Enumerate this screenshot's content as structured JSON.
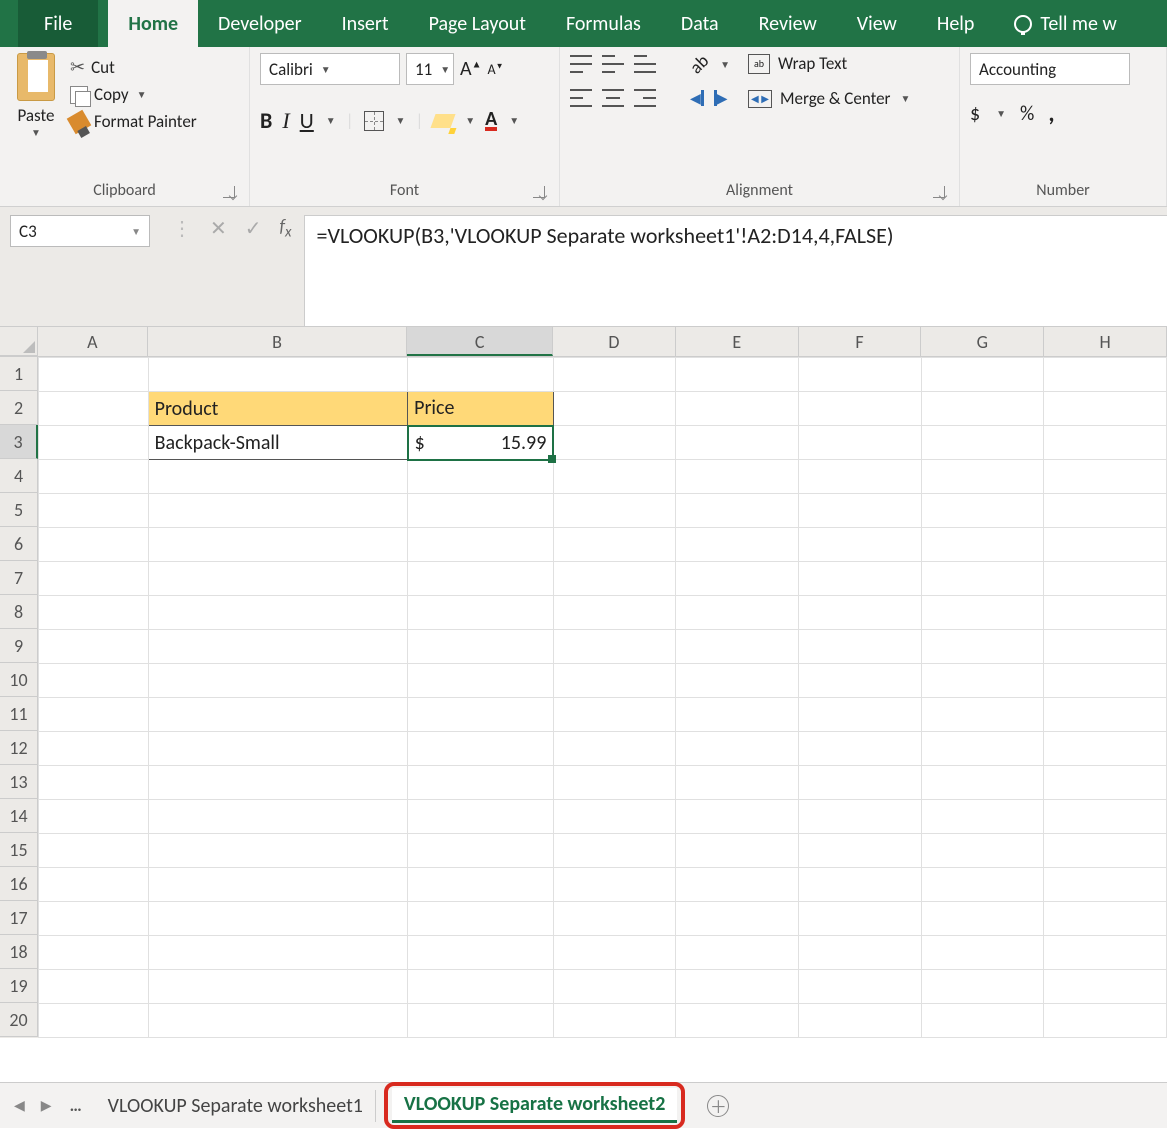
{
  "tabs": {
    "file": "File",
    "home": "Home",
    "developer": "Developer",
    "insert": "Insert",
    "page_layout": "Page Layout",
    "formulas": "Formulas",
    "data": "Data",
    "review": "Review",
    "view": "View",
    "help": "Help",
    "tellme": "Tell me w"
  },
  "ribbon": {
    "clipboard": {
      "paste": "Paste",
      "cut": "Cut",
      "copy": "Copy",
      "format_painter": "Format Painter",
      "group_label": "Clipboard"
    },
    "font": {
      "name": "Calibri",
      "size": "11",
      "group_label": "Font"
    },
    "alignment": {
      "wrap": "Wrap Text",
      "merge": "Merge & Center",
      "group_label": "Alignment"
    },
    "number": {
      "format": "Accounting",
      "dollar": "$",
      "percent": "%",
      "comma": ",",
      "group_label": "Number"
    }
  },
  "formula_bar": {
    "namebox": "C3",
    "formula": "=VLOOKUP(B3,'VLOOKUP Separate worksheet1'!A2:D14,4,FALSE)"
  },
  "columns": [
    "A",
    "B",
    "C",
    "D",
    "E",
    "F",
    "G",
    "H"
  ],
  "rows": [
    "1",
    "2",
    "3",
    "4",
    "5",
    "6",
    "7",
    "8",
    "9",
    "10",
    "11",
    "12",
    "13",
    "14",
    "15",
    "16",
    "17",
    "18",
    "19",
    "20"
  ],
  "cells": {
    "b2": "Product",
    "c2": "Price",
    "b3": "Backpack-Small",
    "c3_currency": "$",
    "c3_value": "15.99"
  },
  "sheets": {
    "s1": "VLOOKUP Separate worksheet1",
    "s2": "VLOOKUP Separate worksheet2"
  }
}
